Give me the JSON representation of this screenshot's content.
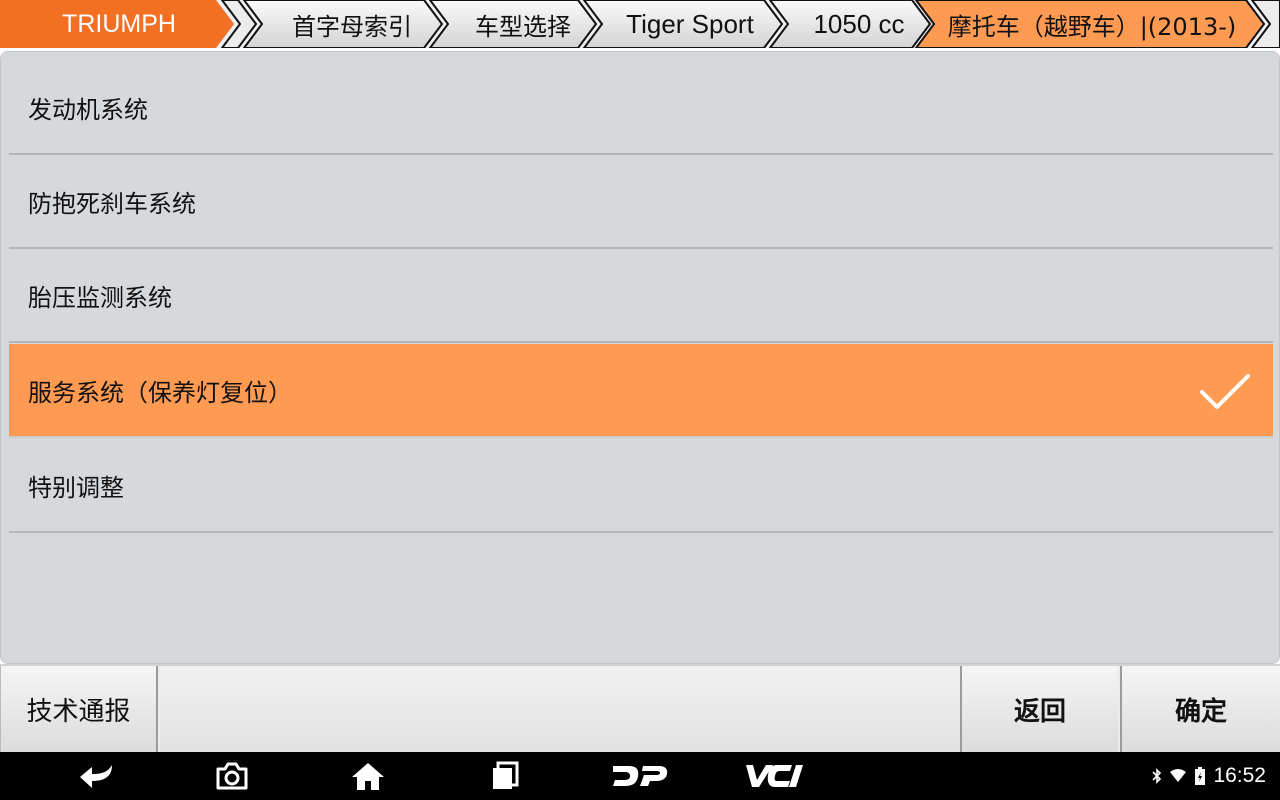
{
  "breadcrumb": {
    "items": [
      {
        "label": "TRIUMPH"
      },
      {
        "label": "首字母索引"
      },
      {
        "label": "车型选择"
      },
      {
        "label": "Tiger Sport"
      },
      {
        "label": "1050 cc"
      },
      {
        "label": "摩托车（越野车）|(2013-)"
      }
    ],
    "active_color": "#f36f21",
    "current_color": "#ff9a52"
  },
  "list": {
    "items": [
      {
        "label": "发动机系统"
      },
      {
        "label": "防抱死刹车系统"
      },
      {
        "label": "胎压监测系统"
      },
      {
        "label": "服务系统（保养灯复位）",
        "selected": true
      },
      {
        "label": "特别调整"
      }
    ],
    "selected_color": "#ff9a52",
    "check_icon": "checkmark-icon"
  },
  "buttons": {
    "tech_bulletin": "技术通报",
    "back": "返回",
    "confirm": "确定"
  },
  "navbar": {
    "icons": [
      "back-arrow-icon",
      "camera-icon",
      "home-icon",
      "recent-apps-icon",
      "dp-logo-icon",
      "vci-logo-icon"
    ],
    "status_icons": [
      "bluetooth-icon",
      "wifi-icon",
      "battery-icon"
    ],
    "time": "16:52"
  }
}
